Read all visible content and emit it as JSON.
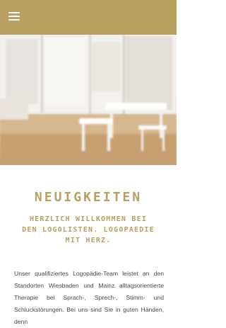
{
  "header": {
    "background_color": "#b9a060",
    "menu_icon": "hamburger-menu-icon"
  },
  "hero": {
    "description_icon": "blurred-office-photo"
  },
  "main": {
    "heading": "NEUIGKEITEN",
    "subheading_lines": [
      "HERZLICH WILLKOMMEN BEI",
      "DEN LOGOLISTEN. LOGOPAEDIE",
      "MIT HERZ."
    ],
    "body": "Unser qualifiziertes Logopädie-Team leistet an den Standorten Wiesbaden und Mainz alltagsorientierte Therapie bei Sprach-, Sprech-, Stimm- und Schluckstörungen. Bei uns sind Sie in guten Händen, denn",
    "accent_color": "#b9a060"
  }
}
